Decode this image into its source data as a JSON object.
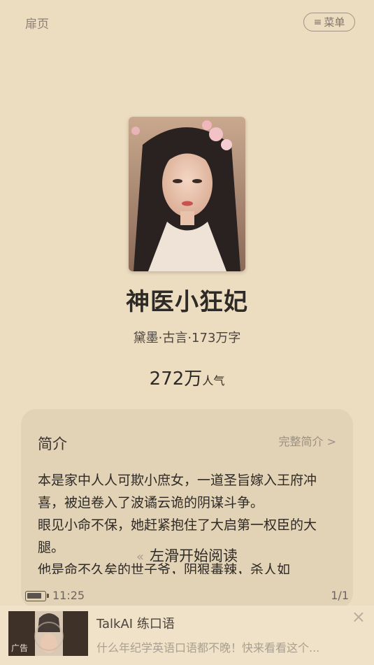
{
  "header": {
    "flyleaf_label": "扉页",
    "menu_icon": "≡",
    "menu_label": "菜单"
  },
  "book": {
    "title": "神医小狂妃",
    "meta": "黛墨·古言·173万字",
    "popularity_value": "272万",
    "popularity_unit": "人气"
  },
  "intro": {
    "heading": "简介",
    "full_link": "完整简介 >",
    "body": "本是家中人人可欺小庶女，一道圣旨嫁入王府冲喜，被迫卷入了波谲云诡的阴谋斗争。\n眼见小命不保，她赶紧抱住了大启第一权臣的大腿。\n他是命不久矣的世子爷，阴狠毒辣，杀人如",
    "swipe_arrow": "«",
    "swipe_hint": "左滑开始阅读"
  },
  "status": {
    "time": "11:25",
    "page": "1/1"
  },
  "ad": {
    "badge": "广告",
    "title": "TalkAI 练口语",
    "description": "什么年纪学英语口语都不晚！快来看看这个...",
    "close": "×"
  }
}
